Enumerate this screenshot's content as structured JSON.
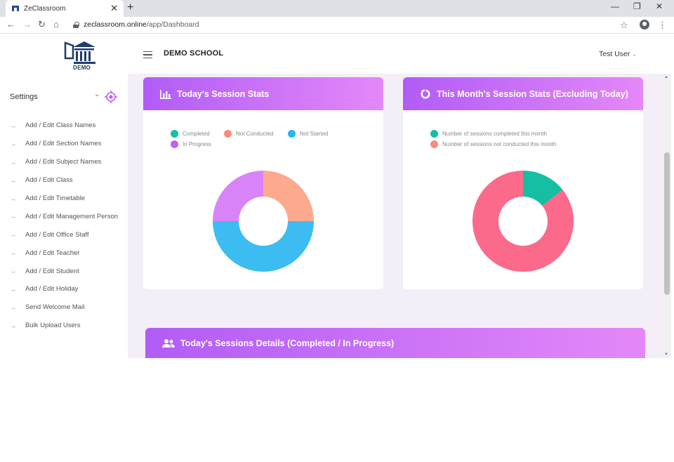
{
  "browser": {
    "tab_title": "ZeClassroom",
    "url_host": "zeclassroom.online",
    "url_path": "/app/Dashboard"
  },
  "sidebar": {
    "logo_text": "DEMO",
    "settings_label": "Settings",
    "items": [
      {
        "label": "Add / Edit Class Names"
      },
      {
        "label": "Add / Edit Section Names"
      },
      {
        "label": "Add / Edit Subject Names"
      },
      {
        "label": "Add / Edit Class"
      },
      {
        "label": "Add / Edit Timetable"
      },
      {
        "label": "Add / Edit Management Person"
      },
      {
        "label": "Add / Edit Office Staff"
      },
      {
        "label": "Add / Edit Teacher"
      },
      {
        "label": "Add / Edit Student"
      },
      {
        "label": "Add / Edit Holiday"
      },
      {
        "label": "Send Welcome Mail"
      },
      {
        "label": "Bulk Upload Users"
      }
    ]
  },
  "header": {
    "school_name": "DEMO SCHOOL",
    "user_name": "Test User"
  },
  "cards": {
    "today": {
      "title": "Today's Session Stats",
      "legend": [
        {
          "label": "Completed",
          "color": "#14bfa4"
        },
        {
          "label": "Not Conducted",
          "color": "#fc8a78"
        },
        {
          "label": "Not Started",
          "color": "#28b4f0"
        },
        {
          "label": "In Progress",
          "color": "#c060f0"
        }
      ]
    },
    "month": {
      "title": "This Month's Session Stats (Excluding Today)",
      "legend": [
        {
          "label": "Number of sessions completed this month",
          "color": "#14bfa4"
        },
        {
          "label": "Number of sessions not conducted this month",
          "color": "#fc8a78"
        }
      ]
    },
    "details": {
      "title": "Today's Sessions Details (Completed / In Progress)"
    }
  },
  "chart_data": [
    {
      "type": "pie",
      "title": "Today's Session Stats",
      "categories": [
        "Completed",
        "Not Conducted",
        "Not Started",
        "In Progress"
      ],
      "values": [
        0,
        1,
        2,
        1
      ],
      "colors": [
        "#14bfa4",
        "#fca98e",
        "#3cbcf0",
        "#d883f8"
      ]
    },
    {
      "type": "pie",
      "title": "This Month's Session Stats (Excluding Today)",
      "categories": [
        "Number of sessions completed this month",
        "Number of sessions not conducted this month"
      ],
      "values": [
        1,
        6
      ],
      "colors": [
        "#14bfa4",
        "#fb6a8b"
      ]
    }
  ]
}
